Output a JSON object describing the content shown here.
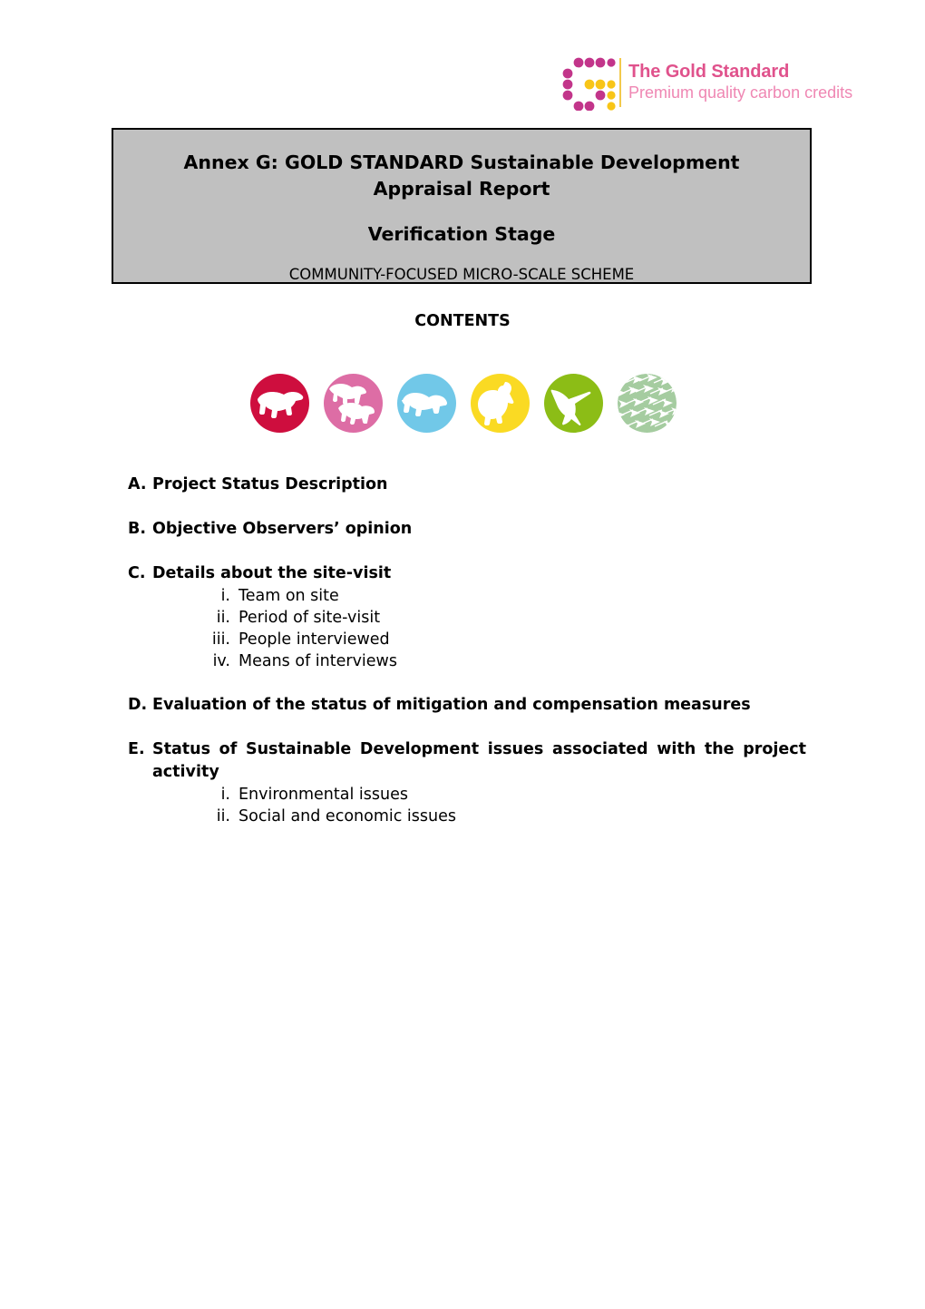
{
  "logo": {
    "name": "gold-standard-logo",
    "title": "The Gold Standard",
    "tagline": "Premium quality carbon credits",
    "mark_colors": {
      "outer": "#c2358a",
      "inner": "#f8c517",
      "divider": "#f2c94c"
    },
    "text_colors": {
      "title": "#e0528c",
      "tagline": "#ef87b3"
    }
  },
  "header": {
    "title": "Annex G: GOLD STANDARD Sustainable Development Appraisal Report",
    "stage": "Verification Stage",
    "scheme": "COMMUNITY-FOCUSED MICRO-SCALE SCHEME",
    "background_color": "#c0c0c0",
    "border_color": "#000000"
  },
  "contents_heading": "CONTENTS",
  "icons": [
    {
      "name": "rhino-icon",
      "color": "#ce0e3e",
      "label": "Rhino"
    },
    {
      "name": "bears-icon",
      "color": "#dd6da5",
      "label": "Bears"
    },
    {
      "name": "polar-bear-icon",
      "color": "#71c8e8",
      "label": "Polar bear"
    },
    {
      "name": "pelican-icon",
      "color": "#fada23",
      "label": "Pelican"
    },
    {
      "name": "hummingbird-icon",
      "color": "#8cbd16",
      "label": "Hummingbird"
    },
    {
      "name": "fish-school-icon",
      "color": "#a5ccа0",
      "label": "Fish school"
    }
  ],
  "toc": [
    {
      "letter": "A.",
      "label": "Project Status Description",
      "justified": false,
      "sub": []
    },
    {
      "letter": "B.",
      "label": "Objective Observers’ opinion",
      "justified": false,
      "sub": []
    },
    {
      "letter": "C.",
      "label": "Details about the site-visit",
      "justified": false,
      "sub": [
        {
          "num": "i.",
          "text": "Team on site"
        },
        {
          "num": "ii.",
          "text": "Period of site-visit"
        },
        {
          "num": "iii.",
          "text": "People interviewed"
        },
        {
          "num": "iv.",
          "text": "Means of interviews"
        }
      ]
    },
    {
      "letter": "D.",
      "label": "Evaluation of the status of mitigation and compensation measures",
      "justified": false,
      "sub": []
    },
    {
      "letter": "E.",
      "label": "Status of Sustainable Development issues associated with the project activity",
      "justified": true,
      "sub": [
        {
          "num": "i.",
          "text": "Environmental issues"
        },
        {
          "num": "ii.",
          "text": "Social and economic issues"
        }
      ]
    }
  ]
}
